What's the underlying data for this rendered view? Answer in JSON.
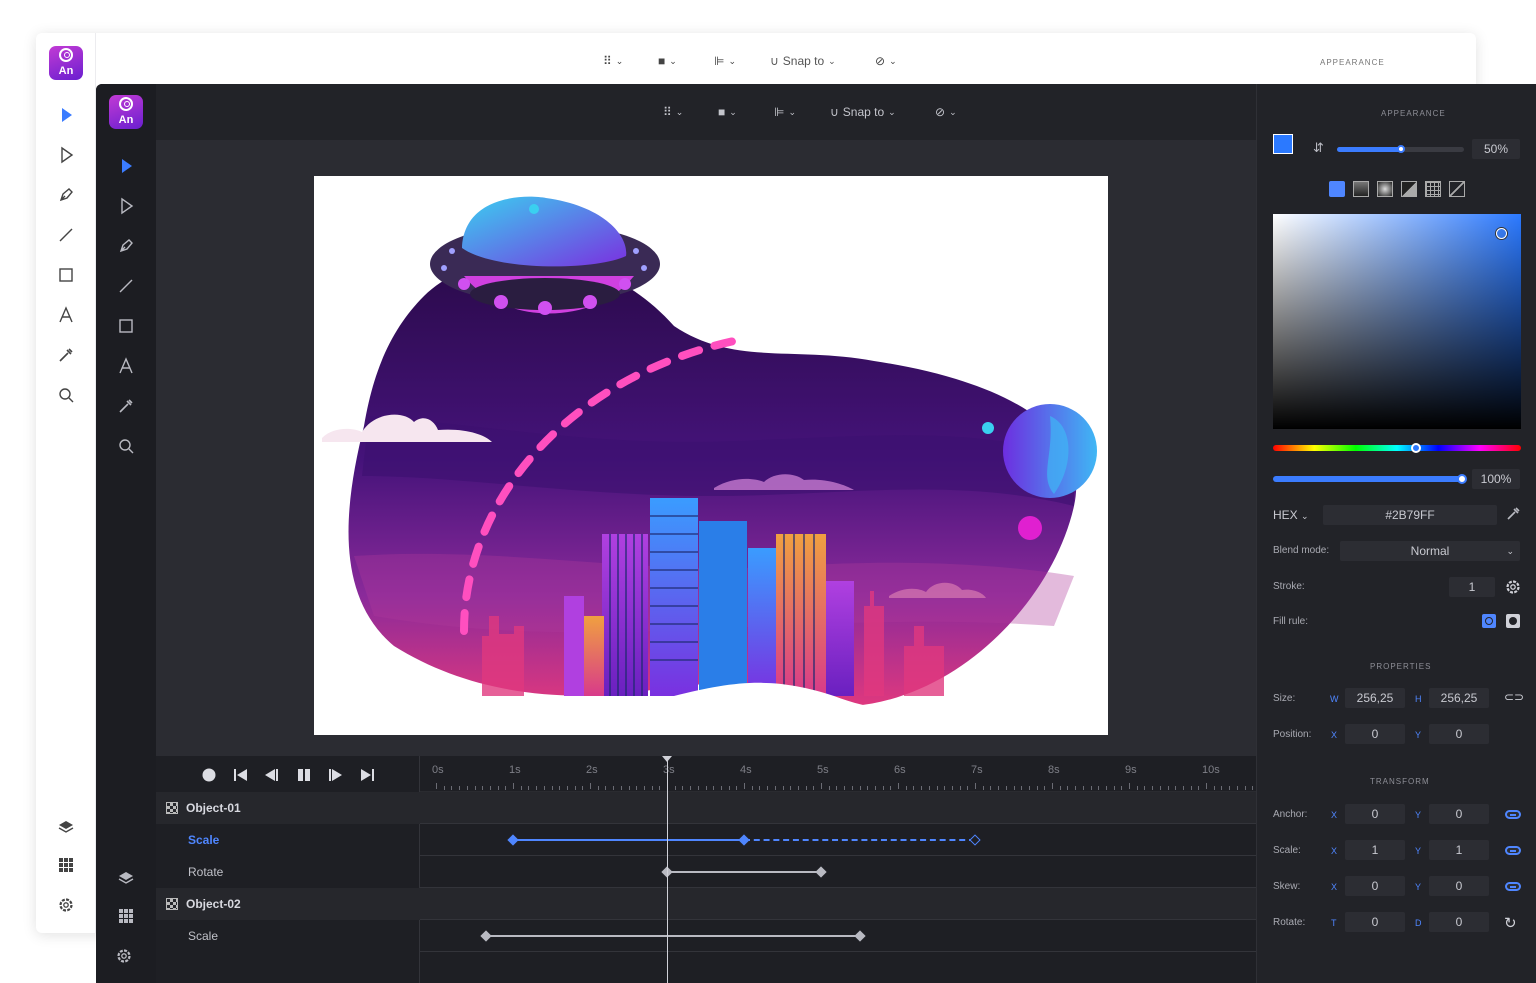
{
  "back_window": {
    "logo_text": "An",
    "toolbar": {
      "snap_label": "Snap to"
    },
    "panel_title": "APPEARANCE"
  },
  "app": {
    "logo_text": "An",
    "tools": [
      "select-arrow",
      "direct-select",
      "pen",
      "line",
      "rectangle",
      "text",
      "eyedropper",
      "zoom"
    ],
    "bottom_tools": [
      "layers",
      "grid",
      "settings"
    ],
    "toolbar": {
      "snap_label": "Snap to"
    }
  },
  "timeline": {
    "ticks": [
      "0s",
      "1s",
      "2s",
      "3s",
      "4s",
      "5s",
      "6s",
      "7s",
      "8s",
      "9s",
      "10s"
    ],
    "playhead_seconds": 3,
    "rows": [
      {
        "type": "object",
        "label": "Object-01"
      },
      {
        "type": "property",
        "label": "Scale",
        "active": true,
        "keyframes": [
          1,
          4,
          7
        ]
      },
      {
        "type": "property",
        "label": "Rotate",
        "keyframes": [
          3,
          5
        ]
      },
      {
        "type": "object",
        "label": "Object-02"
      },
      {
        "type": "property",
        "label": "Scale",
        "keyframes": [
          0.65,
          5.5
        ]
      }
    ]
  },
  "appearance": {
    "title": "APPEARANCE",
    "fill_color": "#2B79FF",
    "opacity": "50%",
    "opacity_level": 0.5,
    "fill_types": [
      "solid",
      "linear",
      "radial",
      "conic",
      "pattern",
      "none"
    ],
    "alpha": "100%",
    "hex_label": "HEX",
    "hex_value": "#2B79FF",
    "blend_label": "Blend mode:",
    "blend_value": "Normal",
    "stroke_label": "Stroke:",
    "stroke_value": "1",
    "fill_rule_label": "Fill rule:"
  },
  "properties": {
    "title": "PROPERTIES",
    "size_label": "Size:",
    "w_axis": "W",
    "w_value": "256,25",
    "h_axis": "H",
    "h_value": "256,25",
    "position_label": "Position:",
    "x_axis": "X",
    "x_value": "0",
    "y_axis": "Y",
    "y_value": "0"
  },
  "transform": {
    "title": "TRANSFORM",
    "rows": [
      {
        "label": "Anchor:",
        "a1": "X",
        "v1": "0",
        "a2": "Y",
        "v2": "0"
      },
      {
        "label": "Scale:",
        "a1": "X",
        "v1": "1",
        "a2": "Y",
        "v2": "1"
      },
      {
        "label": "Skew:",
        "a1": "X",
        "v1": "0",
        "a2": "Y",
        "v2": "0"
      },
      {
        "label": "Rotate:",
        "a1": "T",
        "v1": "0",
        "a2": "D",
        "v2": "0"
      }
    ]
  },
  "colors": {
    "accent": "#4F86FF",
    "panel": "#222328",
    "sidebar": "#1C1D22"
  }
}
